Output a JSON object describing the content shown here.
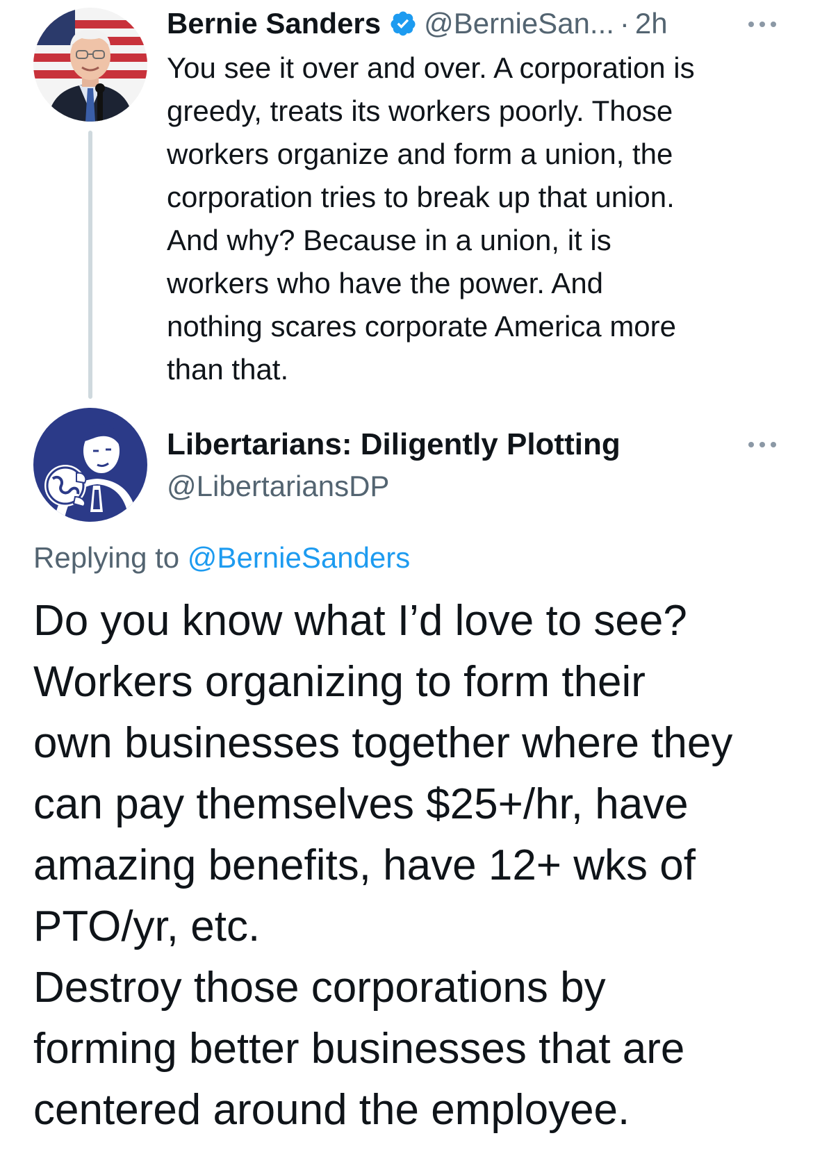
{
  "parent_tweet": {
    "author_name": "Bernie Sanders",
    "verified_icon": "verified-badge-icon",
    "handle": "@BernieSan...",
    "separator": "·",
    "timestamp": "2h",
    "more_icon": "more-options-icon",
    "text": "You see it over and over. A corporation is\ngreedy, treats its workers poorly. Those\nworkers organize and form a union, the\ncorporation tries to break up that union.\nAnd why? Because in a union, it is\nworkers who have the power. And\nnothing scares corporate America more\nthan that."
  },
  "reply_tweet": {
    "author_name": "Libertarians: Diligently Plotting",
    "handle": "@LibertariansDP",
    "more_icon": "more-options-icon",
    "replying_to_label": "Replying to",
    "replying_to_mention": "@BernieSanders",
    "text": "Do you know what I’d love to see?\nWorkers organizing to form their\nown businesses together where they\ncan pay themselves $25+/hr, have\namazing benefits, have 12+ wks of\nPTO/yr, etc.\nDestroy those corporations by\nforming better businesses that are\ncentered around the employee."
  },
  "colors": {
    "text_primary": "#0f1419",
    "text_secondary": "#536471",
    "link_blue": "#1d9bf0",
    "verified_blue": "#1d9bf0",
    "thread_line": "#cfd9de",
    "background": "#ffffff"
  }
}
